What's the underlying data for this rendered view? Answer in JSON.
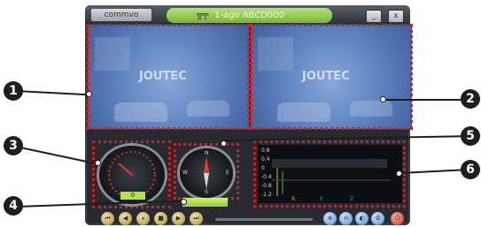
{
  "window": {
    "brand": "commvo",
    "title": "1-ago ABCD000",
    "logo_glyph": "╦╤",
    "minimize_label": "_",
    "close_label": "x"
  },
  "videos": [
    {
      "watermark": "JOUTEC"
    },
    {
      "watermark": "JOUTEC"
    }
  ],
  "gauges": {
    "speed_readout": "0",
    "compass_labels": {
      "n": "N",
      "s": "S",
      "e": "E",
      "w": "W"
    }
  },
  "graph": {
    "y_ticks": [
      "0.8",
      "0.4",
      "0",
      "-0.4",
      "-0.8",
      "-1.2"
    ],
    "legend": [
      "X",
      "Y",
      "Z"
    ]
  },
  "controls": {
    "playback": [
      "⏮",
      "◀",
      "⏸",
      "■",
      "▶",
      "⏭"
    ],
    "view": [
      "⊕",
      "⊖",
      "◐",
      "⚙"
    ],
    "exit": "⏻"
  },
  "callouts": [
    "1",
    "2",
    "3",
    "4",
    "5",
    "6"
  ],
  "colors": {
    "highlight": "#d81c1c",
    "video_tint": "#5a7fbc",
    "accent_green": "#9cc834"
  }
}
